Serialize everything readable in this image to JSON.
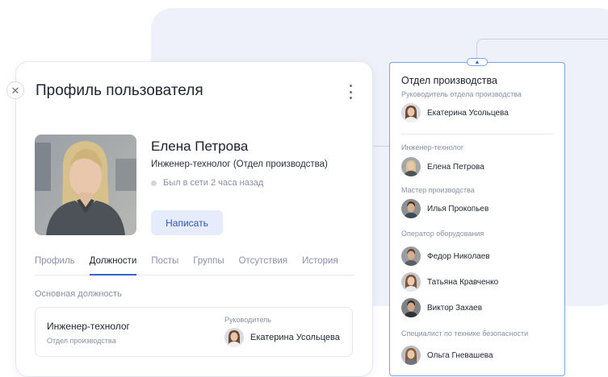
{
  "profile": {
    "title": "Профиль пользователя",
    "close_icon": "close-icon",
    "menu_icon": "kebab-menu-icon",
    "user": {
      "name": "Елена Петрова",
      "role": "Инженер-технолог  (Отдел производства)",
      "status": "Был в сети 2 часа назад",
      "status_color": "#d3d6e2"
    },
    "write_button": "Написать",
    "tabs": [
      "Профиль",
      "Должности",
      "Посты",
      "Группы",
      "Отсутствия",
      "История"
    ],
    "active_tab": "Должности",
    "position_section": {
      "label": "Основная должность",
      "title": "Инженер-технолог",
      "department": "Отдел производства",
      "manager_label": "Руководитель",
      "manager_name": "Екатерина Усольцева"
    }
  },
  "org_panel": {
    "title": "Отдел производства",
    "head_label": "Руководитель отдела производства",
    "head_name": "Екатерина Усольцева",
    "groups": [
      {
        "label": "Инженер-технолог",
        "members": [
          "Елена Петрова"
        ]
      },
      {
        "label": "Мастер производства",
        "members": [
          "Илья Прокопьев"
        ]
      },
      {
        "label": "Оператор оборудования",
        "members": [
          "Федор Николаев",
          "Татьяна Кравченко",
          "Виктор Захаев"
        ]
      },
      {
        "label": "Специалист по технике безопасности",
        "members": [
          "Ольга Гневашева"
        ]
      }
    ]
  },
  "colors": {
    "accent": "#3764c9",
    "button_bg": "#e6ecfb",
    "panel_border": "#7fa3e6",
    "background_panel": "#eef0fa"
  }
}
